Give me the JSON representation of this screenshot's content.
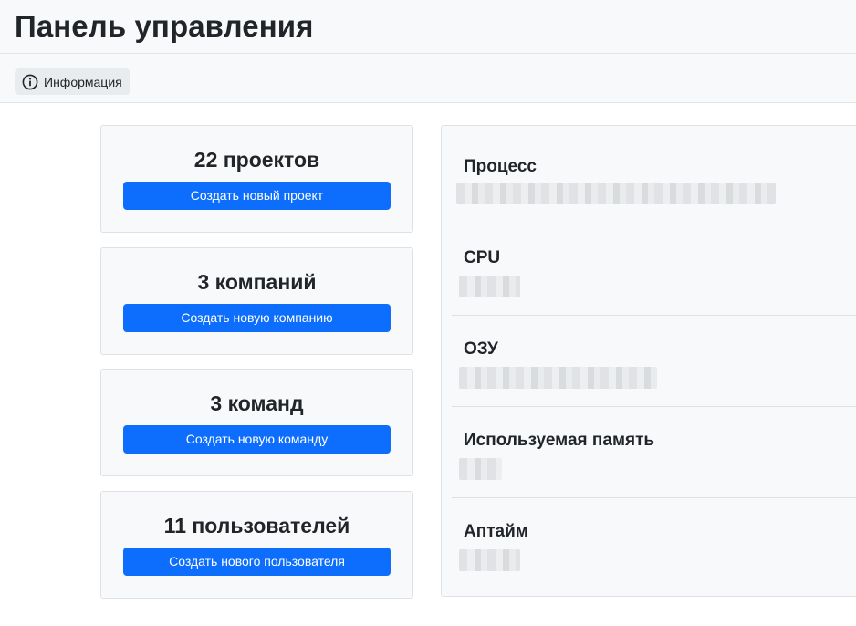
{
  "header": {
    "title": "Панель управления"
  },
  "toolbar": {
    "info_label": "Информация",
    "info_icon": "info-circle-icon"
  },
  "stats": [
    {
      "count": "22 проектов",
      "button": "Создать новый проект"
    },
    {
      "count": "3 компаний",
      "button": "Создать новую компанию"
    },
    {
      "count": "3 команд",
      "button": "Создать новую команду"
    },
    {
      "count": "11 пользователей",
      "button": "Создать нового пользователя"
    }
  ],
  "system": [
    {
      "label": "Процесс"
    },
    {
      "label": "CPU"
    },
    {
      "label": "ОЗУ"
    },
    {
      "label": "Используемая память"
    },
    {
      "label": "Аптайм"
    }
  ],
  "colors": {
    "primary": "#0d6efd",
    "panel_bg": "#f8f9fa",
    "border": "#dee2e6"
  }
}
